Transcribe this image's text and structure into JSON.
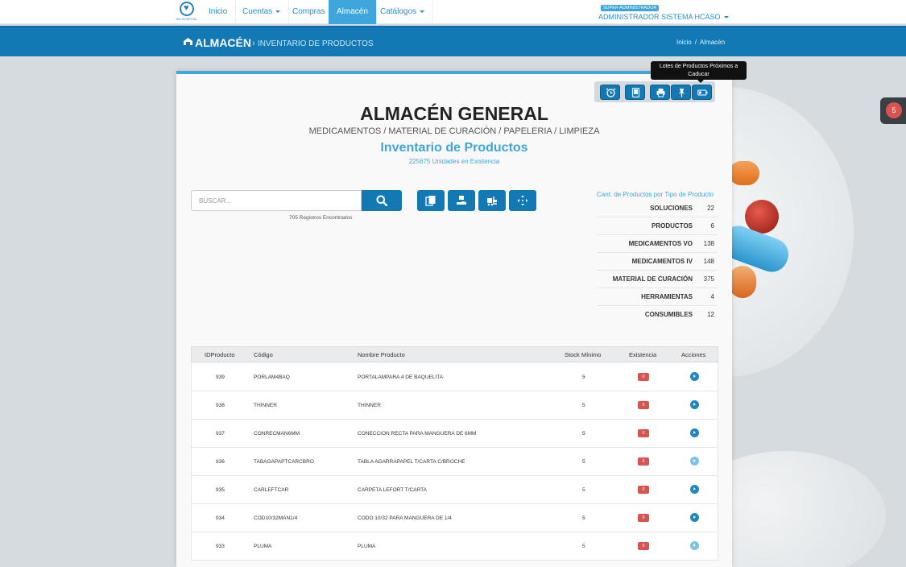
{
  "nav": {
    "logo_text": "BH HOSPITAL",
    "items": [
      {
        "label": "Inicio",
        "dropdown": false,
        "active": false
      },
      {
        "label": "Cuentas",
        "dropdown": true,
        "active": false
      },
      {
        "label": "Compras",
        "dropdown": false,
        "active": false
      },
      {
        "label": "Almacén",
        "dropdown": false,
        "active": true
      },
      {
        "label": "Catálogos",
        "dropdown": true,
        "active": false
      }
    ],
    "role_badge": "SUPER ADMINISTRADOR",
    "user_name": "ADMINISTRADOR SISTEMA HCASO"
  },
  "titlebar": {
    "title": "ALMACÉN",
    "separator": "›",
    "subtitle": "INVENTARIO DE PRODUCTOS",
    "breadcrumb": [
      "Inicio",
      "/",
      "Almacén"
    ]
  },
  "toolbar": {
    "tooltip": "Lotes de Productos Próximos a Caducar",
    "buttons": [
      "alarm-clock-icon",
      "tablet-icon",
      "print-icon",
      "pin-icon",
      "battery-icon"
    ]
  },
  "side_badge": "5",
  "header": {
    "title": "ALMACÉN GENERAL",
    "categories": "MEDICAMENTOS / MATERIAL DE CURACIÓN / PAPELERIA / LIMPIEZA",
    "section": "Inventario de Productos",
    "units": "225675 Unidades en Existencia"
  },
  "search": {
    "placeholder": "BUSCAR...",
    "records": "705 Registros Encontrados"
  },
  "actions": [
    "boxes-icon",
    "hand-box-icon",
    "forklift-icon",
    "arrows-move-icon"
  ],
  "type_counts": {
    "title": "Cant. de Productos por Tipo de Producto",
    "rows": [
      {
        "label": "SOLUCIONES",
        "value": "22"
      },
      {
        "label": "PRODUCTOS",
        "value": "6"
      },
      {
        "label": "MEDICAMENTOS VO",
        "value": "138"
      },
      {
        "label": "MEDICAMENTOS IV",
        "value": "148"
      },
      {
        "label": "MATERIAL DE CURACIÓN",
        "value": "375"
      },
      {
        "label": "HERRAMIENTAS",
        "value": "4"
      },
      {
        "label": "CONSUMIBLES",
        "value": "12"
      }
    ]
  },
  "table": {
    "headers": [
      "IDProducto",
      "Código",
      "Nombre Producto",
      "Stock Mínimo",
      "Existencia",
      "Acciones"
    ],
    "rows": [
      {
        "id": "939",
        "code": "PORLAM4BAQ",
        "name": "PORTALAMPARA 4 DE BAQUELITA",
        "min": "5",
        "stock": "0",
        "light": false
      },
      {
        "id": "938",
        "code": "THINNER",
        "name": "THINNER",
        "min": "5",
        "stock": "0",
        "light": false
      },
      {
        "id": "937",
        "code": "CONRECMAN6MM",
        "name": "CONECCION RECTA PARA MANGUERA DE 6MM",
        "min": "5",
        "stock": "0",
        "light": false
      },
      {
        "id": "936",
        "code": "TABAGAPAPTCARCBRO",
        "name": "TABLA AGARRAPAPEL T/CARTA C/BROCHE",
        "min": "5",
        "stock": "0",
        "light": true
      },
      {
        "id": "935",
        "code": "CARLEFTCAR",
        "name": "CARPETA LEFORT T/CARTA",
        "min": "5",
        "stock": "0",
        "light": false
      },
      {
        "id": "934",
        "code": "COD10/32MAN1/4",
        "name": "CODO 10/32 PARA MANGUERA DE 1/4",
        "min": "5",
        "stock": "0",
        "light": false
      },
      {
        "id": "933",
        "code": "PLUMA",
        "name": "PLUMA",
        "min": "5",
        "stock": "0",
        "light": true
      }
    ]
  },
  "colors": {
    "primary": "#1279b5",
    "accent": "#3fa6db",
    "danger": "#d9534f"
  }
}
